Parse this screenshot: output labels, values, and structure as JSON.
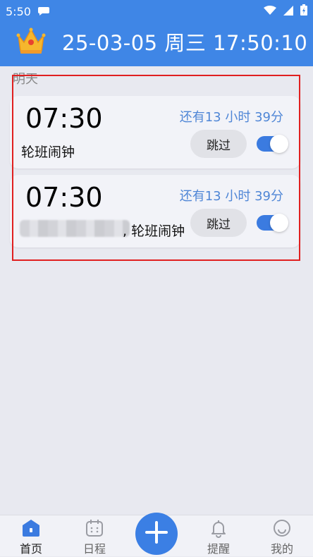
{
  "status_bar": {
    "time": "5:50"
  },
  "header": {
    "date_title": "25-03-05 周三 17:50:10",
    "accent_color": "#3f86e6"
  },
  "section": {
    "label": "明天"
  },
  "alarms": [
    {
      "time": "07:30",
      "name": "轮班闹钟",
      "remaining": "还有13 小时 39分",
      "skip_label": "跳过",
      "enabled": true
    },
    {
      "time": "07:30",
      "name": ", 轮班闹钟",
      "remaining": "还有13 小时 39分",
      "skip_label": "跳过",
      "enabled": true
    }
  ],
  "bottom_nav": {
    "items": [
      {
        "label": "首页",
        "icon": "home-icon",
        "active": true
      },
      {
        "label": "日程",
        "icon": "calendar-icon",
        "active": false
      },
      {
        "label": "提醒",
        "icon": "bell-icon",
        "active": false
      },
      {
        "label": "我的",
        "icon": "smiley-icon",
        "active": false
      }
    ],
    "add_icon": "plus-icon"
  }
}
